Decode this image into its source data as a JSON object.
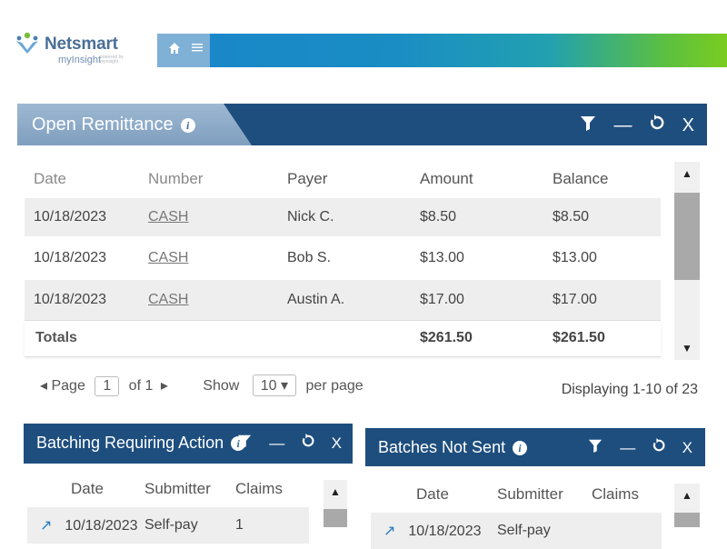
{
  "brand": {
    "name": "Netsmart",
    "product": "myInsight",
    "tagline": "powered by mynsight"
  },
  "topbar": {
    "home_icon": "home-icon",
    "menu_icon": "menu-icon"
  },
  "open_remittance": {
    "title": "Open Remittance",
    "columns": [
      "Date",
      "Number",
      "Payer",
      "Amount",
      "Balance"
    ],
    "rows": [
      {
        "date": "10/18/2023",
        "number": "CASH",
        "payer": "Nick C.",
        "amount": "$8.50",
        "balance": "$8.50"
      },
      {
        "date": "10/18/2023",
        "number": "CASH",
        "payer": "Bob S.",
        "amount": "$13.00",
        "balance": "$13.00"
      },
      {
        "date": "10/18/2023",
        "number": "CASH",
        "payer": "Austin A.",
        "amount": "$17.00",
        "balance": "$17.00"
      }
    ],
    "totals": {
      "label": "Totals",
      "amount": "$261.50",
      "balance": "$261.50"
    },
    "pager": {
      "page_label": "Page",
      "page": "1",
      "of_label": "of 1",
      "show_label": "Show",
      "per_page": "10",
      "per_page_label": "per page"
    },
    "displaying": "Displaying 1-10 of 23"
  },
  "batching": {
    "title": "Batching Requiring Action",
    "columns": [
      "Date",
      "Submitter",
      "Claims"
    ],
    "row": {
      "date": "10/18/2023",
      "submitter": "Self-pay",
      "claims": "1"
    }
  },
  "not_sent": {
    "title": "Batches Not Sent",
    "columns": [
      "Date",
      "Submitter",
      "Claims"
    ],
    "row": {
      "date": "10/18/2023",
      "submitter": "Self-pay"
    }
  },
  "colors": {
    "header_blue": "#1e4e7e",
    "title_tab": "#8fabc8",
    "row_grey": "#eeeeee"
  }
}
